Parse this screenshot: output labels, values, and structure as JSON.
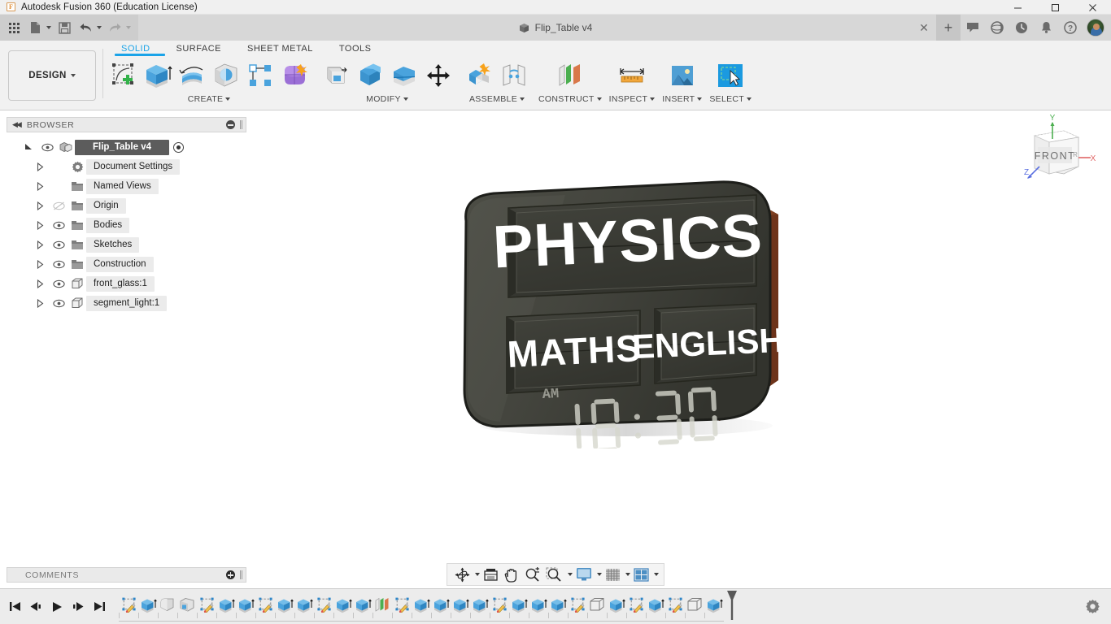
{
  "titlebar": {
    "app_title": "Autodesk Fusion 360 (Education License)",
    "logo_letter": "F",
    "minimize": "—",
    "maximize": "☐",
    "close": "✕"
  },
  "quick_access": {
    "items": [
      {
        "name": "app-grid-button",
        "label": "Grid"
      },
      {
        "name": "new-file-button",
        "label": "New"
      },
      {
        "name": "save-button",
        "label": "Save"
      },
      {
        "name": "undo-button",
        "label": "Undo"
      },
      {
        "name": "redo-button",
        "label": "Redo"
      }
    ]
  },
  "document_tab": {
    "title": "Flip_Table v4",
    "close_label": "✕",
    "new_tab_label": "+"
  },
  "header_tools": [
    {
      "name": "comments-icon",
      "label": "Comments"
    },
    {
      "name": "job-status-icon",
      "label": "Job Status"
    },
    {
      "name": "recent-activity-icon",
      "label": "Recent"
    },
    {
      "name": "notifications-icon",
      "label": "Notifications"
    },
    {
      "name": "help-icon",
      "label": "Help"
    }
  ],
  "workspace": {
    "selector_label": "DESIGN"
  },
  "ribbon": {
    "tabs": [
      {
        "label": "SOLID",
        "active": true
      },
      {
        "label": "SURFACE",
        "active": false
      },
      {
        "label": "SHEET METAL",
        "active": false
      },
      {
        "label": "TOOLS",
        "active": false
      }
    ],
    "panels": [
      {
        "label": "CREATE",
        "has_dropdown": true,
        "tools": [
          {
            "name": "create-sketch-tool",
            "label": "Create Sketch"
          },
          {
            "name": "extrude-tool",
            "label": "Extrude"
          },
          {
            "name": "revolve-tool",
            "label": "Revolve"
          },
          {
            "name": "sweep-tool",
            "label": "Sweep"
          },
          {
            "name": "pattern-tool",
            "label": "Rectangular Pattern"
          },
          {
            "name": "form-tool",
            "label": "Create Form"
          }
        ]
      },
      {
        "label": "MODIFY",
        "has_dropdown": true,
        "tools": [
          {
            "name": "press-pull-tool",
            "label": "Press Pull"
          },
          {
            "name": "fillet-tool",
            "label": "Fillet"
          },
          {
            "name": "combine-tool",
            "label": "Combine"
          },
          {
            "name": "shell-tool",
            "label": "Shell"
          },
          {
            "name": "move-copy-tool",
            "label": "Move/Copy"
          }
        ]
      },
      {
        "label": "ASSEMBLE",
        "has_dropdown": true,
        "tools": [
          {
            "name": "new-component-tool",
            "label": "New Component"
          },
          {
            "name": "joint-tool",
            "label": "Joint"
          }
        ]
      },
      {
        "label": "CONSTRUCT",
        "has_dropdown": true,
        "tools": [
          {
            "name": "offset-plane-tool",
            "label": "Offset Plane"
          }
        ]
      },
      {
        "label": "INSPECT",
        "has_dropdown": true,
        "tools": [
          {
            "name": "measure-tool",
            "label": "Measure"
          }
        ]
      },
      {
        "label": "INSERT",
        "has_dropdown": true,
        "tools": [
          {
            "name": "insert-image-tool",
            "label": "Canvas"
          }
        ]
      },
      {
        "label": "SELECT",
        "has_dropdown": true,
        "tools": [
          {
            "name": "select-tool",
            "label": "Select"
          }
        ]
      }
    ]
  },
  "browser": {
    "title": "BROWSER",
    "collapse_label": "◀◀",
    "tree": [
      {
        "label": "Flip_Table v4",
        "icon": "component-icon",
        "root": true,
        "indent": 0,
        "eye": "visible",
        "has_radio": true
      },
      {
        "label": "Document Settings",
        "icon": "gear-icon",
        "indent": 1,
        "eye": "none"
      },
      {
        "label": "Named Views",
        "icon": "folder-icon",
        "indent": 1,
        "eye": "none"
      },
      {
        "label": "Origin",
        "icon": "folder-icon",
        "indent": 1,
        "eye": "hidden"
      },
      {
        "label": "Bodies",
        "icon": "folder-icon",
        "indent": 1,
        "eye": "visible"
      },
      {
        "label": "Sketches",
        "icon": "folder-icon",
        "indent": 1,
        "eye": "visible"
      },
      {
        "label": "Construction",
        "icon": "folder-icon",
        "indent": 1,
        "eye": "visible"
      },
      {
        "label": "front_glass:1",
        "icon": "body-icon",
        "indent": 1,
        "eye": "visible"
      },
      {
        "label": "segment_light:1",
        "icon": "body-icon",
        "indent": 1,
        "eye": "visible"
      }
    ]
  },
  "comments_panel": {
    "title": "COMMENTS"
  },
  "viewcube": {
    "face_label": "FRONT",
    "axis_x": "X",
    "axis_y": "Y",
    "axis_z": "Z",
    "color_x": "#e06666",
    "color_y": "#4caf50",
    "color_z": "#5a6fe0"
  },
  "model": {
    "name": "Flip clock subject display board",
    "panel_top": "PHYSICS",
    "panel_left": "MATHS",
    "panel_right": "ENGLISH",
    "meridiem": "AM",
    "time_hours": "10",
    "time_separator": ":",
    "time_minutes": "30",
    "body_color": "#3f4039",
    "wood_color": "#8b4425",
    "text_color": "#ffffff"
  },
  "navbar": {
    "buttons": [
      {
        "name": "orbit-button",
        "label": "Orbit",
        "dropdown": true
      },
      {
        "name": "look-at-button",
        "label": "Look At",
        "dropdown": false
      },
      {
        "name": "pan-button",
        "label": "Pan",
        "dropdown": false
      },
      {
        "name": "zoom-button",
        "label": "Zoom",
        "dropdown": false
      },
      {
        "name": "fit-button",
        "label": "Fit",
        "dropdown": true
      },
      {
        "name": "display-settings-button",
        "label": "Display Settings",
        "dropdown": true
      },
      {
        "name": "grid-snaps-button",
        "label": "Grid and Snaps",
        "dropdown": true
      },
      {
        "name": "viewport-layout-button",
        "label": "Viewports",
        "dropdown": true
      }
    ]
  },
  "timeline": {
    "playback": [
      {
        "name": "timeline-begin-button",
        "label": "Go to Beginning"
      },
      {
        "name": "timeline-step-back-button",
        "label": "Step Back"
      },
      {
        "name": "timeline-play-button",
        "label": "Play"
      },
      {
        "name": "timeline-step-forward-button",
        "label": "Step Forward"
      },
      {
        "name": "timeline-end-button",
        "label": "Go to End"
      }
    ],
    "features": [
      {
        "type": "sketch",
        "label": "Sketch"
      },
      {
        "type": "extrude",
        "label": "Extrude"
      },
      {
        "type": "fillet",
        "label": "Fillet"
      },
      {
        "type": "shell",
        "label": "Shell"
      },
      {
        "type": "sketch",
        "label": "Sketch"
      },
      {
        "type": "extrude",
        "label": "Extrude"
      },
      {
        "type": "extrude",
        "label": "Extrude"
      },
      {
        "type": "sketch",
        "label": "Sketch"
      },
      {
        "type": "extrude",
        "label": "Extrude"
      },
      {
        "type": "extrude",
        "label": "Extrude"
      },
      {
        "type": "sketch",
        "label": "Sketch"
      },
      {
        "type": "extrude",
        "label": "Extrude"
      },
      {
        "type": "extrude",
        "label": "Extrude"
      },
      {
        "type": "plane",
        "label": "Offset Plane"
      },
      {
        "type": "sketch",
        "label": "Sketch"
      },
      {
        "type": "extrude",
        "label": "Extrude"
      },
      {
        "type": "extrude",
        "label": "Extrude"
      },
      {
        "type": "extrude",
        "label": "Extrude"
      },
      {
        "type": "extrude",
        "label": "Extrude"
      },
      {
        "type": "sketch",
        "label": "Sketch"
      },
      {
        "type": "extrude",
        "label": "Extrude"
      },
      {
        "type": "extrude",
        "label": "Extrude"
      },
      {
        "type": "extrude",
        "label": "Extrude"
      },
      {
        "type": "sketch",
        "label": "Sketch"
      },
      {
        "type": "body",
        "label": "Body"
      },
      {
        "type": "extrude",
        "label": "Extrude"
      },
      {
        "type": "sketch",
        "label": "Sketch"
      },
      {
        "type": "extrude",
        "label": "Extrude"
      },
      {
        "type": "sketch",
        "label": "Sketch"
      },
      {
        "type": "body",
        "label": "Body"
      },
      {
        "type": "extrude",
        "label": "Extrude"
      }
    ],
    "settings_label": "Timeline Settings"
  }
}
